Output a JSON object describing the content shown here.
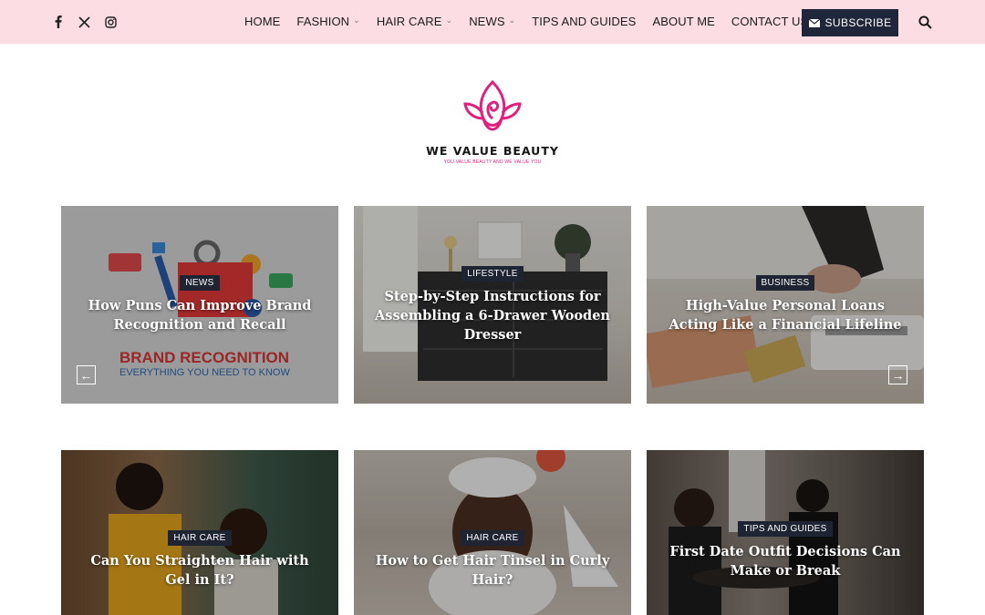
{
  "header": {
    "social": [
      "facebook-icon",
      "x-icon",
      "instagram-icon"
    ],
    "nav": [
      {
        "label": "HOME",
        "dropdown": false
      },
      {
        "label": "FASHION",
        "dropdown": true
      },
      {
        "label": "HAIR CARE",
        "dropdown": true
      },
      {
        "label": "NEWS",
        "dropdown": true
      },
      {
        "label": "TIPS AND GUIDES",
        "dropdown": false
      },
      {
        "label": "ABOUT ME",
        "dropdown": false
      },
      {
        "label": "CONTACT US",
        "dropdown": false
      }
    ],
    "subscribe_label": "SUBSCRIBE",
    "colors": {
      "bar": "#fbdde3",
      "subscribe_bg": "#20263a",
      "brand": "#e0207f"
    }
  },
  "logo": {
    "title": "WE VALUE BEAUTY",
    "tagline": "YOU VALUE BEAUTY AND WE VALUE YOU"
  },
  "slider": {
    "cards": [
      {
        "category": "NEWS",
        "title": "How Puns Can Improve Brand Recognition and Recall",
        "image_text_1": "BRAND RECOGNITION",
        "image_text_2": "EVERYTHING YOU NEED TO KNOW"
      },
      {
        "category": "LIFESTYLE",
        "title": "Step-by-Step Instructions for Assembling a 6-Drawer Wooden Dresser"
      },
      {
        "category": "BUSINESS",
        "title": "High-Value Personal Loans Acting Like a Financial Lifeline"
      }
    ],
    "prev_icon": "arrow-left-icon",
    "next_icon": "arrow-right-icon"
  },
  "grid": {
    "cards": [
      {
        "category": "HAIR CARE",
        "title": "Can You Straighten Hair with Gel in It?"
      },
      {
        "category": "HAIR CARE",
        "title": "How to Get Hair Tinsel in Curly Hair?"
      },
      {
        "category": "TIPS AND GUIDES",
        "title": "First Date Outfit Decisions Can Make or Break"
      }
    ]
  }
}
